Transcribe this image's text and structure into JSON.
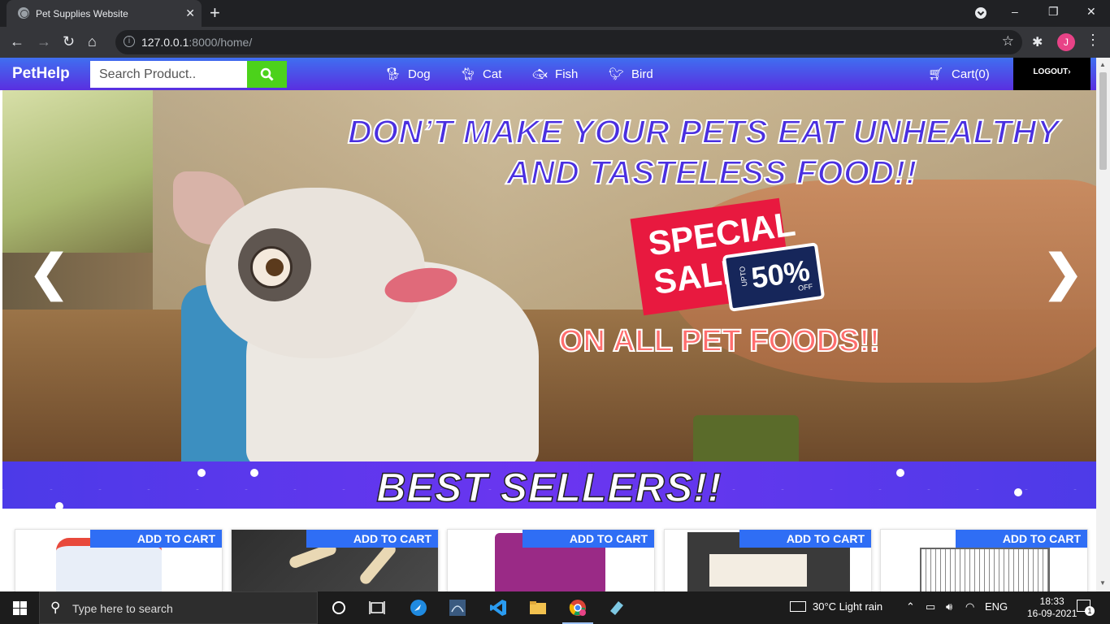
{
  "browser": {
    "tab_title": "Pet Supplies Website",
    "url_host": "127.0.0.1",
    "url_path": ":8000/home/",
    "profile_initial": "J"
  },
  "site": {
    "brand": "PetHelp",
    "search_placeholder": "Search Product..",
    "nav": [
      {
        "label": "Dog",
        "icon": "dog-icon"
      },
      {
        "label": "Cat",
        "icon": "cat-icon"
      },
      {
        "label": "Fish",
        "icon": "fish-icon"
      },
      {
        "label": "Bird",
        "icon": "bird-icon"
      }
    ],
    "cart_label": "Cart(0)",
    "logout_label": "LOGOUT"
  },
  "hero": {
    "headline_line1": "DON’T MAKE YOUR PETS EAT UNHEALTHY",
    "headline_line2": "AND TASTELESS FOOD!!",
    "sale_line1": "SPECIAL",
    "sale_line2": "SALE",
    "upto_label": "UPTO",
    "discount": "50%",
    "off_label": "OFF",
    "subline": "ON ALL PET FOODS!!"
  },
  "best_sellers": {
    "title": "BEST SELLERS!!",
    "add_to_cart_label": "ADD TO CART",
    "products": [
      {
        "name": "aqueon-product"
      },
      {
        "name": "dog-bone-treats"
      },
      {
        "name": "whiskas-junior"
      },
      {
        "name": "fruit-mix-bird-food"
      },
      {
        "name": "bird-cage"
      }
    ]
  },
  "taskbar": {
    "search_placeholder": "Type here to search",
    "weather": "30°C  Light rain",
    "language": "ENG",
    "time": "18:33",
    "date": "16-09-2021",
    "notifications": "1"
  },
  "colors": {
    "navbar_start": "#3f6ff0",
    "navbar_end": "#5a2fe0",
    "search_button": "#4cd21b",
    "add_to_cart": "#2f6ef5"
  }
}
